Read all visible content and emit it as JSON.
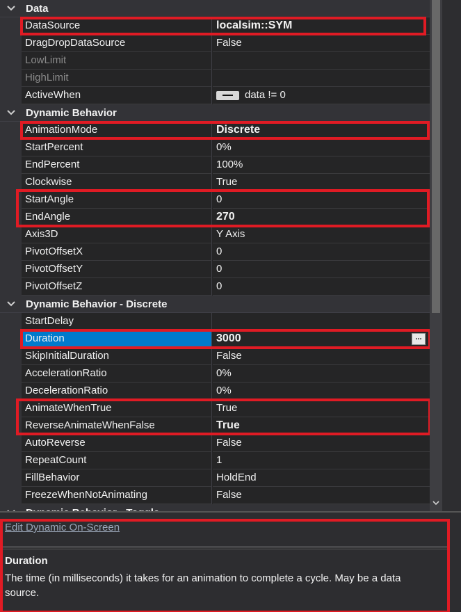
{
  "categories": [
    {
      "label": "Data"
    },
    {
      "label": "Dynamic Behavior"
    },
    {
      "label": "Dynamic Behavior - Discrete"
    },
    {
      "label": "Dynamic Behavior - Toggle"
    }
  ],
  "rows": [
    {
      "name": "DataSource",
      "value": "localsim::SYM"
    },
    {
      "name": "DragDropDataSource",
      "value": "False"
    },
    {
      "name": "LowLimit",
      "value": ""
    },
    {
      "name": "HighLimit",
      "value": ""
    },
    {
      "name": "ActiveWhen",
      "value": "data != 0"
    },
    {
      "name": "AnimationMode",
      "value": "Discrete"
    },
    {
      "name": "StartPercent",
      "value": "0%"
    },
    {
      "name": "EndPercent",
      "value": "100%"
    },
    {
      "name": "Clockwise",
      "value": "True"
    },
    {
      "name": "StartAngle",
      "value": "0"
    },
    {
      "name": "EndAngle",
      "value": "270"
    },
    {
      "name": "Axis3D",
      "value": "Y Axis"
    },
    {
      "name": "PivotOffsetX",
      "value": "0"
    },
    {
      "name": "PivotOffsetY",
      "value": "0"
    },
    {
      "name": "PivotOffsetZ",
      "value": "0"
    },
    {
      "name": "StartDelay",
      "value": ""
    },
    {
      "name": "Duration",
      "value": "3000",
      "button": "..."
    },
    {
      "name": "SkipInitialDuration",
      "value": "False"
    },
    {
      "name": "AccelerationRatio",
      "value": "0%"
    },
    {
      "name": "DecelerationRatio",
      "value": "0%"
    },
    {
      "name": "AnimateWhenTrue",
      "value": "True"
    },
    {
      "name": "ReverseAnimateWhenFalse",
      "value": "True"
    },
    {
      "name": "AutoReverse",
      "value": "False"
    },
    {
      "name": "RepeatCount",
      "value": "1"
    },
    {
      "name": "FillBehavior",
      "value": "HoldEnd"
    },
    {
      "name": "FreezeWhenNotAnimating",
      "value": "False"
    }
  ],
  "bottom": {
    "link": "Edit Dynamic On-Screen",
    "desc_title": "Duration",
    "desc_text": "The time (in milliseconds) it takes for an animation to complete a cycle.  May be a data source."
  },
  "colors": {
    "highlight": "#e01b24",
    "selected": "#007acc",
    "tag_yellow": "#e2c04a",
    "tag_blue": "#3b7fd0"
  },
  "icons": [
    "chevron-down-icon",
    "data-tag-icon",
    "ellipsis-button",
    "toggle-icon",
    "scroll-down-arrow-icon"
  ]
}
